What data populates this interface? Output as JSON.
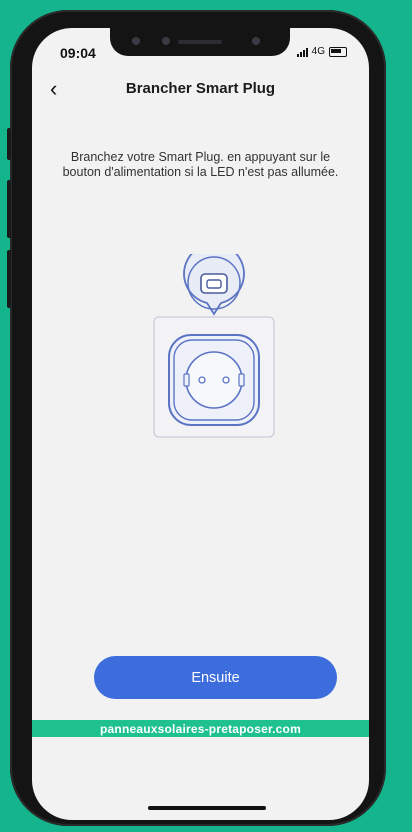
{
  "status_bar": {
    "time": "09:04",
    "network": "4G",
    "icons": [
      "signal-icon",
      "battery-icon"
    ]
  },
  "header": {
    "back_icon": "chevron-left-icon",
    "back_glyph": "‹",
    "title": "Brancher Smart Plug"
  },
  "main": {
    "instruction": "Branchez votre Smart Plug. en appuyant sur le bouton d'alimentation si la LED n'est pas allumée.",
    "illustration_icon": "smart-plug-socket-icon"
  },
  "footer": {
    "next_button_label": "Ensuite"
  },
  "watermark": {
    "text": "panneauxsolaires-pretaposer.com"
  },
  "colors": {
    "background": "#14b48c",
    "accent": "#3d6cdc",
    "illustration_stroke": "#5b74c4",
    "watermark_bg": "#1fc18f"
  }
}
